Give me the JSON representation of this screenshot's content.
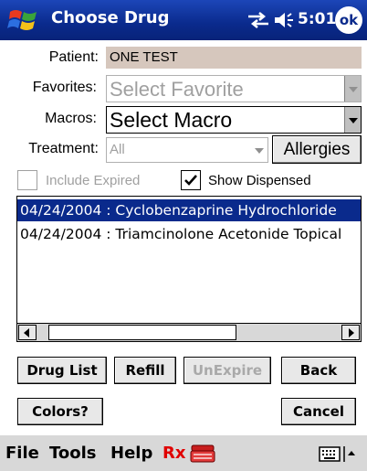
{
  "titlebar": {
    "title": "Choose Drug",
    "time": "5:01",
    "ok_label": "ok",
    "start_icon": "windows-flag-icon",
    "connectivity_icon": "connectivity-icon",
    "volume_icon": "speaker-icon",
    "background_color": "#0a2a8c"
  },
  "form": {
    "patient_label": "Patient:",
    "patient_value": "ONE TEST",
    "favorites_label": "Favorites:",
    "favorites_value": "Select Favorite",
    "macros_label": "Macros:",
    "macros_value": "Select Macro",
    "treatment_label": "Treatment:",
    "treatment_value": "All",
    "allergies_label": "Allergies"
  },
  "options": {
    "include_expired_label": "Include Expired",
    "include_expired_checked": false,
    "show_dispensed_label": "Show Dispensed",
    "show_dispensed_checked": true
  },
  "list": {
    "items": [
      {
        "date": "04/24/2004",
        "text": "04/24/2004 : Cyclobenzaprine Hydrochloride",
        "selected": true
      },
      {
        "date": "04/24/2004",
        "text": "04/24/2004 : Triamcinolone Acetonide Topical",
        "selected": false
      }
    ]
  },
  "buttons": {
    "drug_list": "Drug List",
    "refill": "Refill",
    "unexpire": "UnExpire",
    "back": "Back",
    "colors": "Colors?",
    "cancel": "Cancel"
  },
  "menubar": {
    "file": "File",
    "tools": "Tools",
    "help": "Help",
    "rx": "Rx",
    "rx_color": "#e00000",
    "pill_icon": "pill-box-icon",
    "keyboard_icon": "keyboard-icon",
    "arrow_icon": "input-panel-arrow-icon"
  }
}
